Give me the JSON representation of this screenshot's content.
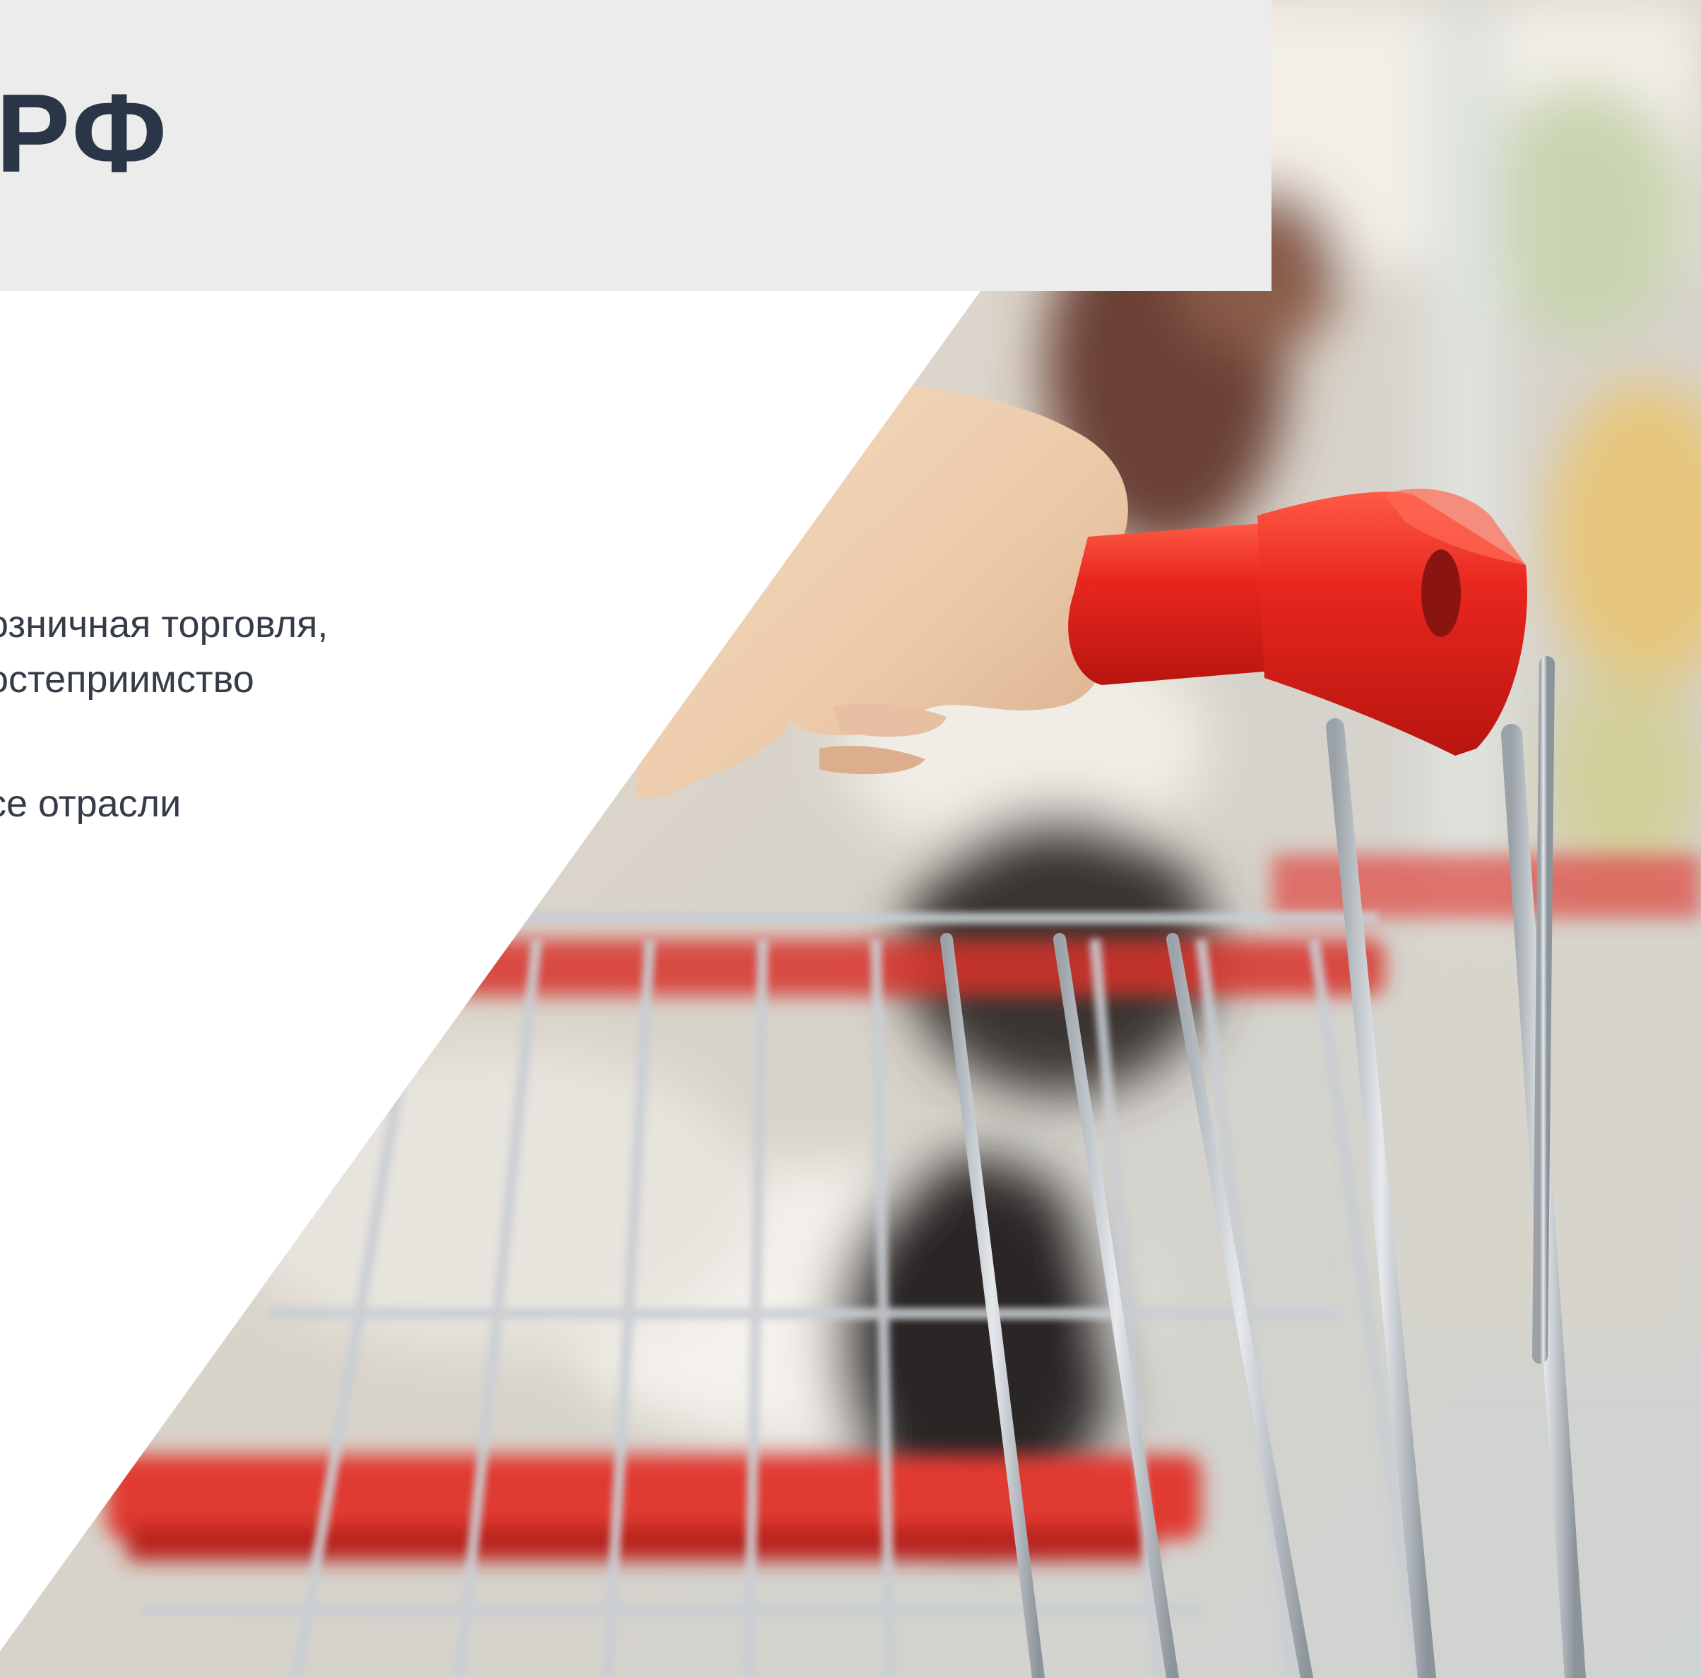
{
  "slide": {
    "title": "РФ",
    "sectors": [
      "озничная торговля,",
      "остеприимство",
      "се отрасли"
    ]
  },
  "colors": {
    "title": "#2a3547",
    "body_text": "#343c48",
    "header_band": "#ececec",
    "handle_red": "#e02a24",
    "cart_metal": "#c8ccd0"
  },
  "image": {
    "subject": "hand-pushing-shopping-cart"
  }
}
